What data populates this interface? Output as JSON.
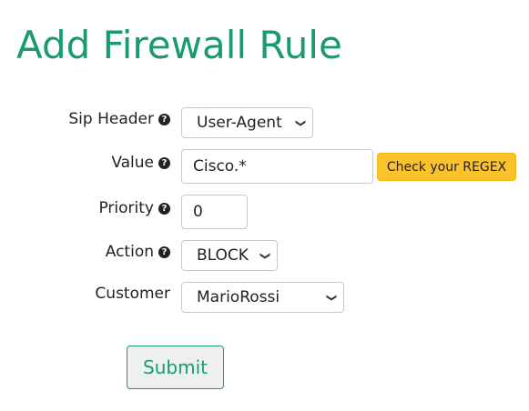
{
  "page": {
    "title": "Add Firewall Rule"
  },
  "form": {
    "sip_header": {
      "label": "Sip Header",
      "value": "User-Agent"
    },
    "value": {
      "label": "Value",
      "value": "Cisco.*"
    },
    "priority": {
      "label": "Priority",
      "value": "0"
    },
    "action": {
      "label": "Action",
      "value": "BLOCK"
    },
    "customer": {
      "label": "Customer",
      "value": "MarioRossi"
    },
    "check_regex_label": "Check your REGEX",
    "submit_label": "Submit"
  },
  "icons": {
    "help": "question-circle-icon",
    "dropdown": "chevron-down-icon"
  },
  "colors": {
    "title": "#1a9b6c",
    "regex_button": "#fcc12b",
    "submit_border": "#1a9b6c",
    "submit_text": "#1a9b6c"
  }
}
